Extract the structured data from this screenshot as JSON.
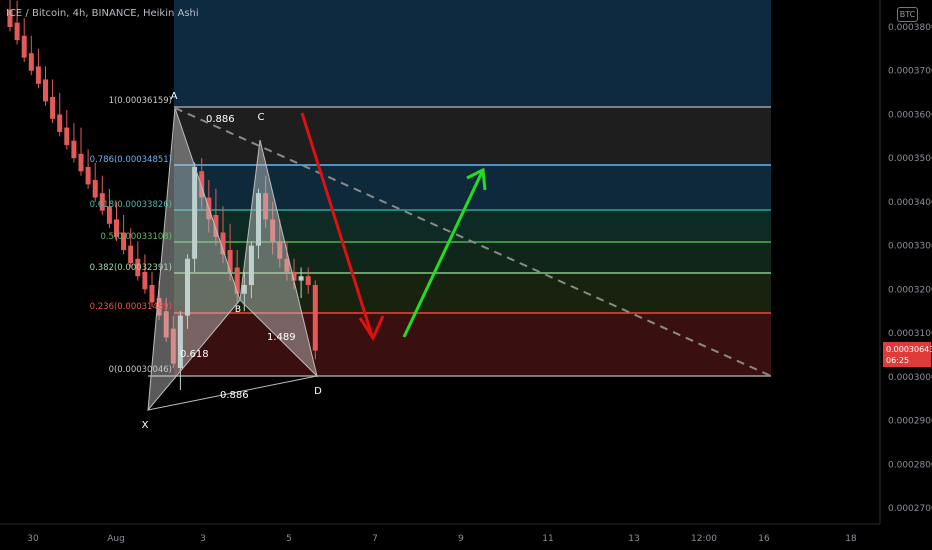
{
  "symbol_title": "ICE / Bitcoin, 4h, BINANCE, Heikin Ashi",
  "currency_badge": "BTC",
  "price_tag": {
    "price": "0.00030643",
    "countdown": "06:25"
  },
  "price_axis": [
    "0.00038000",
    "0.00037000",
    "0.00036000",
    "0.00035000",
    "0.00034000",
    "0.00033000",
    "0.00032000",
    "0.00031000",
    "0.00030000",
    "0.00029000",
    "0.00028000",
    "0.00027000"
  ],
  "time_axis": [
    "30",
    "Aug",
    "3",
    "5",
    "7",
    "9",
    "11",
    "13",
    "12:00",
    "16",
    "18"
  ],
  "fib_labels": {
    "l1": "1(0.00036159)",
    "l786": "0.786(0.00034851)",
    "l618": "0.618(0.00033826)",
    "l5": "0.5(0.00033108)",
    "l382": "0.382(0.00032391)",
    "l236": "0.236(0.00031489)",
    "l0": "0(0.00030046)"
  },
  "pattern_points": {
    "x": "X",
    "a": "A",
    "b": "B",
    "c": "C",
    "d": "D"
  },
  "ratios": {
    "ab": "0.618",
    "bc": "0.886",
    "cd": "1.489",
    "xd": "0.886"
  },
  "colors": {
    "fib_1": "#9e9e9e",
    "fib_786": "#64b5f6",
    "fib_618": "#26a69a",
    "fib_5": "#4caf50",
    "fib_382": "#81c784",
    "fib_236": "#f44336",
    "fib_0": "#9e9e9e",
    "bull": "#b7d7d1",
    "bear": "#e35a5a",
    "arrow_down": "#e01010",
    "arrow_up": "#22dd22"
  },
  "chart_data": {
    "type": "candlestick",
    "title": "ICE / Bitcoin, 4h, BINANCE, Heikin Ashi",
    "ylim": [
      0.000265,
      0.000385
    ],
    "candles": [
      {
        "o": 0.000384,
        "h": 0.000388,
        "l": 0.000379,
        "c": 0.00038
      },
      {
        "o": 0.000381,
        "h": 0.000386,
        "l": 0.000376,
        "c": 0.000377
      },
      {
        "o": 0.000378,
        "h": 0.000382,
        "l": 0.000372,
        "c": 0.000373
      },
      {
        "o": 0.000374,
        "h": 0.000378,
        "l": 0.000369,
        "c": 0.00037
      },
      {
        "o": 0.000371,
        "h": 0.000375,
        "l": 0.000366,
        "c": 0.000367
      },
      {
        "o": 0.000368,
        "h": 0.000371,
        "l": 0.000362,
        "c": 0.000363
      },
      {
        "o": 0.000364,
        "h": 0.000368,
        "l": 0.000358,
        "c": 0.000359
      },
      {
        "o": 0.00036,
        "h": 0.000365,
        "l": 0.000355,
        "c": 0.000356
      },
      {
        "o": 0.000357,
        "h": 0.000361,
        "l": 0.000352,
        "c": 0.000353
      },
      {
        "o": 0.000354,
        "h": 0.000358,
        "l": 0.000349,
        "c": 0.00035
      },
      {
        "o": 0.000351,
        "h": 0.000357,
        "l": 0.000346,
        "c": 0.000347
      },
      {
        "o": 0.000348,
        "h": 0.000352,
        "l": 0.000343,
        "c": 0.000344
      },
      {
        "o": 0.000345,
        "h": 0.000349,
        "l": 0.00034,
        "c": 0.000341
      },
      {
        "o": 0.000342,
        "h": 0.000346,
        "l": 0.000337,
        "c": 0.000338
      },
      {
        "o": 0.000339,
        "h": 0.000343,
        "l": 0.000334,
        "c": 0.000335
      },
      {
        "o": 0.000336,
        "h": 0.00034,
        "l": 0.000331,
        "c": 0.000332
      },
      {
        "o": 0.000333,
        "h": 0.000337,
        "l": 0.000328,
        "c": 0.000329
      },
      {
        "o": 0.00033,
        "h": 0.000334,
        "l": 0.000325,
        "c": 0.000326
      },
      {
        "o": 0.000327,
        "h": 0.000331,
        "l": 0.000322,
        "c": 0.000323
      },
      {
        "o": 0.000324,
        "h": 0.000328,
        "l": 0.000319,
        "c": 0.00032
      },
      {
        "o": 0.000321,
        "h": 0.000324,
        "l": 0.000316,
        "c": 0.000317
      },
      {
        "o": 0.000318,
        "h": 0.000322,
        "l": 0.000313,
        "c": 0.000314
      },
      {
        "o": 0.000315,
        "h": 0.000318,
        "l": 0.000308,
        "c": 0.000309
      },
      {
        "o": 0.000311,
        "h": 0.000314,
        "l": 0.000302,
        "c": 0.000303
      },
      {
        "o": 0.000302,
        "h": 0.000315,
        "l": 0.000297,
        "c": 0.000314
      },
      {
        "o": 0.000314,
        "h": 0.000328,
        "l": 0.000311,
        "c": 0.000327
      },
      {
        "o": 0.000327,
        "h": 0.000349,
        "l": 0.000324,
        "c": 0.000348
      },
      {
        "o": 0.000347,
        "h": 0.00035,
        "l": 0.000338,
        "c": 0.000341
      },
      {
        "o": 0.000341,
        "h": 0.000345,
        "l": 0.000333,
        "c": 0.000336
      },
      {
        "o": 0.000337,
        "h": 0.000343,
        "l": 0.00033,
        "c": 0.000332
      },
      {
        "o": 0.000333,
        "h": 0.000339,
        "l": 0.000326,
        "c": 0.000328
      },
      {
        "o": 0.000329,
        "h": 0.000335,
        "l": 0.000322,
        "c": 0.000324
      },
      {
        "o": 0.000325,
        "h": 0.000329,
        "l": 0.000317,
        "c": 0.000319
      },
      {
        "o": 0.000319,
        "h": 0.000324,
        "l": 0.000315,
        "c": 0.000321
      },
      {
        "o": 0.000321,
        "h": 0.000331,
        "l": 0.000318,
        "c": 0.00033
      },
      {
        "o": 0.00033,
        "h": 0.000343,
        "l": 0.000327,
        "c": 0.000342
      },
      {
        "o": 0.000342,
        "h": 0.000346,
        "l": 0.000334,
        "c": 0.000336
      },
      {
        "o": 0.000336,
        "h": 0.00034,
        "l": 0.000328,
        "c": 0.000331
      },
      {
        "o": 0.000331,
        "h": 0.000336,
        "l": 0.000325,
        "c": 0.000327
      },
      {
        "o": 0.000327,
        "h": 0.000331,
        "l": 0.000322,
        "c": 0.000324
      },
      {
        "o": 0.000324,
        "h": 0.000327,
        "l": 0.00032,
        "c": 0.000322
      },
      {
        "o": 0.000322,
        "h": 0.000325,
        "l": 0.000318,
        "c": 0.000323
      },
      {
        "o": 0.000323,
        "h": 0.000325,
        "l": 0.000319,
        "c": 0.000321
      },
      {
        "o": 0.000321,
        "h": 0.000322,
        "l": 0.000304,
        "c": 0.000306
      }
    ]
  }
}
